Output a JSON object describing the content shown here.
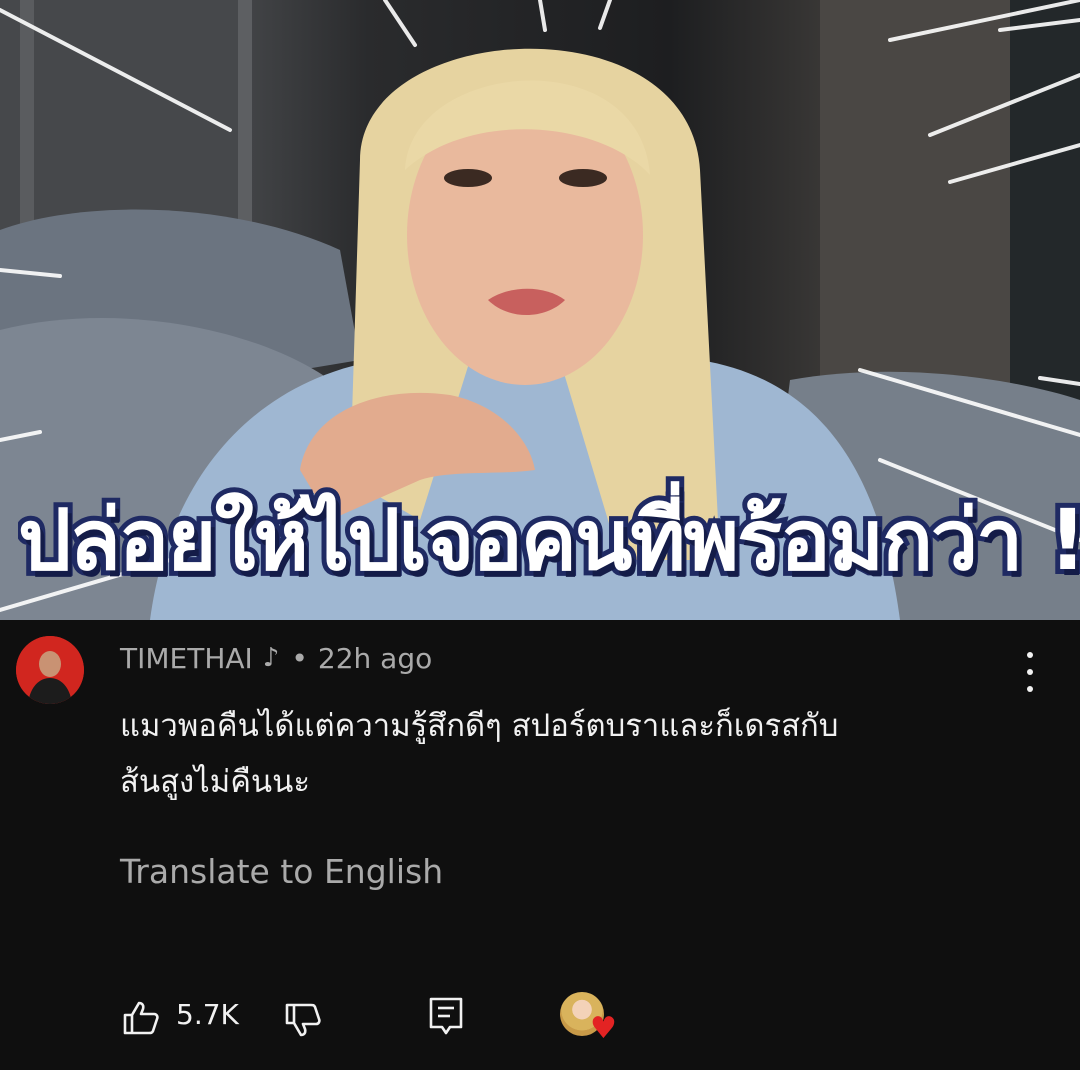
{
  "video": {
    "caption": "ปล่อยให้ไปเจอคนที่พร้อมกว่า !!"
  },
  "comment": {
    "author": "TIMETHAI",
    "time": "22h ago",
    "text_line1": "แมวพอคืนได้แต่ความรู้สึกดีๆ สปอร์ตบราและก็เดรสกับ",
    "text_line2": "ส้นสูงไม่คืนนะ",
    "translate_label": "Translate to English",
    "like_count": "5.7K",
    "creator_hearted": true
  },
  "icons": {
    "author_badge": "music-note-icon",
    "menu": "more-vertical-icon",
    "like": "thumbs-up-icon",
    "dislike": "thumbs-down-icon",
    "reply": "comment-icon",
    "heart": "heart-icon"
  },
  "colors": {
    "background": "#0f0f0f",
    "primary_text": "#f1f1f1",
    "secondary_text": "#aaaaaa",
    "avatar_red": "#d1261f",
    "heart": "#e32323",
    "caption_stroke": "#1f2a63"
  }
}
